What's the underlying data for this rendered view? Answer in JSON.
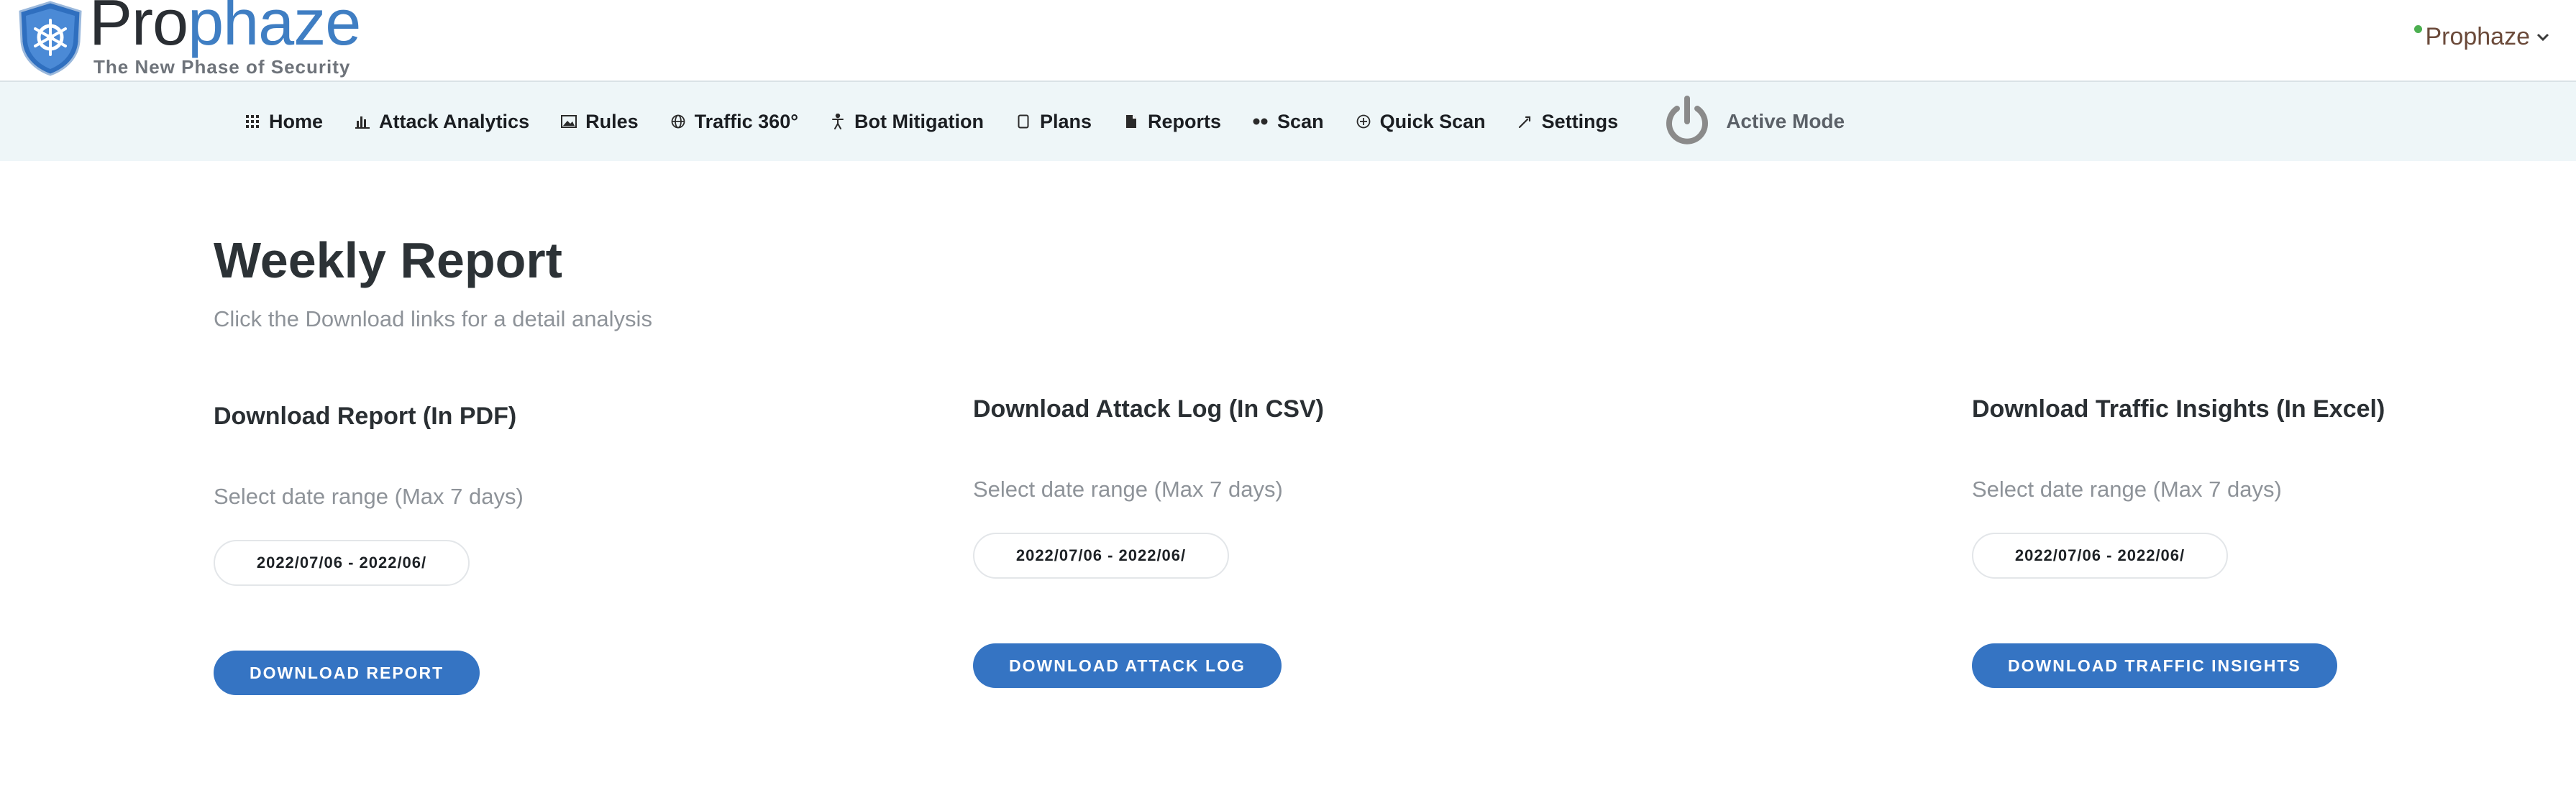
{
  "brand": {
    "name_part1": "Pro",
    "name_part2": "phaze",
    "tagline": "The New Phase of Security",
    "accent": "#3f7ec3"
  },
  "account": {
    "name": "Prophaze",
    "status_color": "#4caf50",
    "chevron": "⌄"
  },
  "nav": {
    "items": [
      {
        "label": "Home",
        "icon": "grid-icon"
      },
      {
        "label": "Attack Analytics",
        "icon": "bar-chart-icon"
      },
      {
        "label": "Rules",
        "icon": "image-icon"
      },
      {
        "label": "Traffic 360°",
        "icon": "globe-icon"
      },
      {
        "label": "Bot Mitigation",
        "icon": "person-icon"
      },
      {
        "label": "Plans",
        "icon": "box-icon"
      },
      {
        "label": "Reports",
        "icon": "file-icon"
      },
      {
        "label": "Scan",
        "icon": "dots-icon"
      },
      {
        "label": "Quick Scan",
        "icon": "plus-circle-icon"
      },
      {
        "label": "Settings",
        "icon": "wrench-icon"
      }
    ],
    "mode_label": "Active Mode"
  },
  "page": {
    "title": "Weekly Report",
    "subtitle": "Click the Download links for a detail analysis"
  },
  "sections": [
    {
      "title": "Download Report (In PDF)",
      "range_label": "Select date range (Max 7 days)",
      "date_value": "2022/07/06 - 2022/06/",
      "button_label": "DOWNLOAD REPORT"
    },
    {
      "title": "Download Attack Log (In CSV)",
      "range_label": "Select date range (Max 7 days)",
      "date_value": "2022/07/06 - 2022/06/",
      "button_label": "DOWNLOAD ATTACK LOG"
    },
    {
      "title": "Download Traffic Insights (In Excel)",
      "range_label": "Select date range (Max 7 days)",
      "date_value": "2022/07/06 - 2022/06/",
      "button_label": "DOWNLOAD TRAFFIC INSIGHTS"
    }
  ],
  "colors": {
    "nav_bg": "#eef6f8",
    "button_bg": "#3574c3"
  }
}
